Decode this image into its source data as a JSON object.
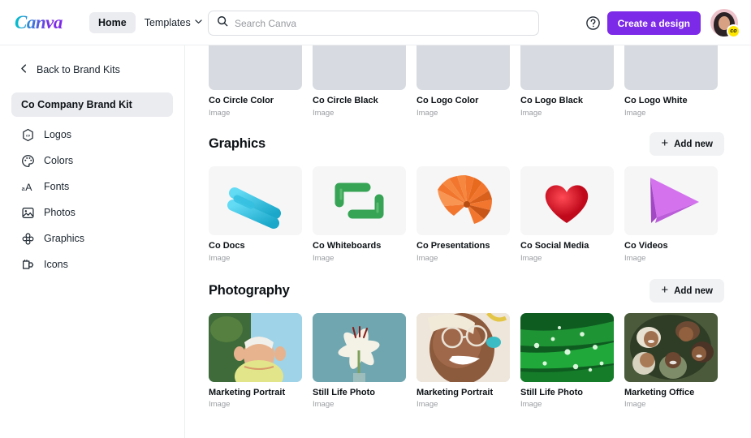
{
  "header": {
    "brand": "Canva",
    "nav": [
      {
        "label": "Home",
        "active": true
      },
      {
        "label": "Templates",
        "active": false
      }
    ],
    "search": {
      "placeholder": "Search Canva",
      "value": "",
      "icon": "search-icon"
    },
    "icons": [
      "help-icon",
      "gear-icon",
      "bell-icon"
    ],
    "cta_label": "Create a design",
    "avatar_badge": "co",
    "accent_color": "#7d2ae8"
  },
  "sidebar": {
    "back_label": "Back to Brand Kits",
    "kit_title": "Co Company Brand Kit",
    "items": [
      {
        "label": "Logos",
        "icon": "hexagon-logo-icon"
      },
      {
        "label": "Colors",
        "icon": "palette-icon"
      },
      {
        "label": "Fonts",
        "icon": "font-size-icon"
      },
      {
        "label": "Photos",
        "icon": "photo-icon"
      },
      {
        "label": "Graphics",
        "icon": "flower-graphic-icon"
      },
      {
        "label": "Icons",
        "icon": "sticker-icon"
      }
    ]
  },
  "main": {
    "logos_row": {
      "items": [
        {
          "title": "Co Circle Color",
          "subtitle": "Image",
          "style": "circle-yellow"
        },
        {
          "title": "Co Circle Black",
          "subtitle": "Image",
          "style": "circle-black"
        },
        {
          "title": "Co Logo Color",
          "subtitle": "Image",
          "style": "wordmark-yellow"
        },
        {
          "title": "Co Logo Black",
          "subtitle": "Image",
          "style": "wordmark-black"
        },
        {
          "title": "Co Logo White",
          "subtitle": "Image",
          "style": "wordmark-white"
        }
      ]
    },
    "sections": [
      {
        "title": "Graphics",
        "add_label": "Add new",
        "items": [
          {
            "title": "Co Docs",
            "subtitle": "Image",
            "color": "#35c0e0"
          },
          {
            "title": "Co Whiteboards",
            "subtitle": "Image",
            "color": "#34a853"
          },
          {
            "title": "Co Presentations",
            "subtitle": "Image",
            "color": "#f2762e"
          },
          {
            "title": "Co Social Media",
            "subtitle": "Image",
            "color": "#e8212f"
          },
          {
            "title": "Co Videos",
            "subtitle": "Image",
            "color": "#cc5de8"
          }
        ]
      },
      {
        "title": "Photography",
        "add_label": "Add new",
        "items": [
          {
            "title": "Marketing Portrait",
            "subtitle": "Image",
            "color": "#8aa86b"
          },
          {
            "title": "Still Life Photo",
            "subtitle": "Image",
            "color": "#7fb0b8"
          },
          {
            "title": "Marketing Portrait",
            "subtitle": "Image",
            "color": "#c79a7e"
          },
          {
            "title": "Still Life Photo",
            "subtitle": "Image",
            "color": "#1f8f3a"
          },
          {
            "title": "Marketing Office",
            "subtitle": "Image",
            "color": "#6f7a58"
          }
        ]
      }
    ]
  }
}
